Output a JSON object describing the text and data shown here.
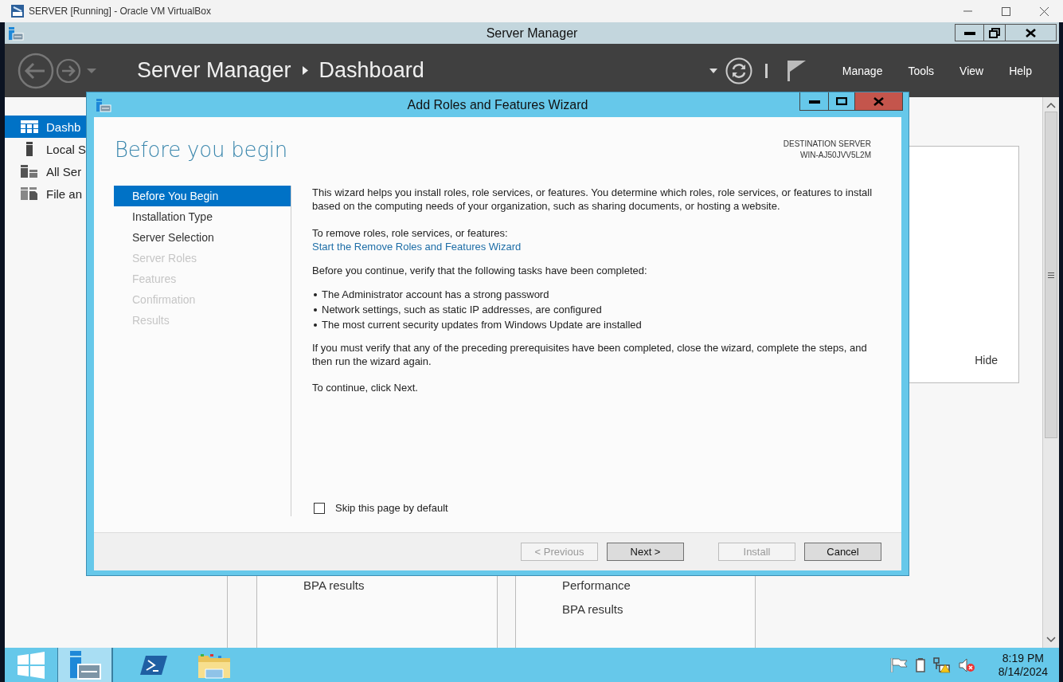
{
  "vm_window": {
    "title": "SERVER [Running] - Oracle VM VirtualBox"
  },
  "server_manager": {
    "title": "Server Manager",
    "breadcrumb": [
      "Server Manager",
      "Dashboard"
    ],
    "menu": [
      "Manage",
      "Tools",
      "View",
      "Help"
    ],
    "sidebar": [
      {
        "kind": "dashboard",
        "label": "Dashb",
        "selected": true
      },
      {
        "kind": "local-server",
        "label": "Local S",
        "selected": false
      },
      {
        "kind": "all-servers",
        "label": "All Ser",
        "selected": false
      },
      {
        "kind": "file-services",
        "label": "File an",
        "selected": false
      }
    ],
    "hide_link": "Hide",
    "cards": [
      {
        "lines": [
          "BPA results"
        ]
      },
      {
        "lines": [
          "Performance",
          "BPA results"
        ]
      }
    ]
  },
  "wizard": {
    "title": "Add Roles and Features Wizard",
    "heading": "Before you begin",
    "destination_label": "DESTINATION SERVER",
    "destination_server": "WIN-AJ50JVV5L2M",
    "steps": [
      {
        "label": "Before You Begin",
        "selected": true,
        "disabled": false
      },
      {
        "label": "Installation Type",
        "selected": false,
        "disabled": false
      },
      {
        "label": "Server Selection",
        "selected": false,
        "disabled": false
      },
      {
        "label": "Server Roles",
        "selected": false,
        "disabled": true
      },
      {
        "label": "Features",
        "selected": false,
        "disabled": true
      },
      {
        "label": "Confirmation",
        "selected": false,
        "disabled": true
      },
      {
        "label": "Results",
        "selected": false,
        "disabled": true
      }
    ],
    "intro": "This wizard helps you install roles, role services, or features. You determine which roles, role services, or features to install based on the computing needs of your organization, such as sharing documents, or hosting a website.",
    "remove_label": "To remove roles, role services, or features:",
    "remove_link": "Start the Remove Roles and Features Wizard",
    "tasks_intro": "Before you continue, verify that the following tasks have been completed:",
    "tasks": [
      "The Administrator account has a strong password",
      "Network settings, such as static IP addresses, are configured",
      "The most current security updates from Windows Update are installed"
    ],
    "verify_note": "If you must verify that any of the preceding prerequisites have been completed, close the wizard, complete the steps, and then run the wizard again.",
    "continue_note": "To continue, click Next.",
    "skip_checkbox": {
      "label": "Skip this page by default",
      "checked": false
    },
    "buttons": [
      {
        "label": "< Previous",
        "disabled": true
      },
      {
        "label": "Next >",
        "disabled": false
      },
      {
        "label": "Install",
        "disabled": true
      },
      {
        "label": "Cancel",
        "disabled": false
      }
    ]
  },
  "taskbar": {
    "items": [
      {
        "kind": "server-manager",
        "selected": true
      },
      {
        "kind": "powershell",
        "selected": false
      },
      {
        "kind": "explorer",
        "selected": false
      }
    ],
    "time": "8:19 PM",
    "date": "8/14/2024"
  }
}
